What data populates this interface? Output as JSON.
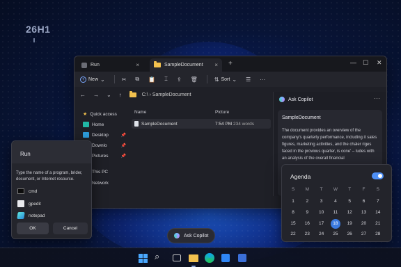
{
  "desktop": {
    "version_label": "26H1"
  },
  "explorer": {
    "tabs": [
      {
        "label": "Run",
        "close": "×"
      },
      {
        "label": "SampleDocument",
        "close": "×"
      }
    ],
    "new_tab": "+",
    "controls": {
      "minimize": "—",
      "maximize": "☐",
      "close": "✕"
    },
    "toolbar": {
      "new_label": "New",
      "sort_label": "Sort",
      "more": "···"
    },
    "address": {
      "path": "C:\\ › SampleDocument"
    },
    "sidebar": [
      {
        "label": "Quick access",
        "icon": "star-icon"
      },
      {
        "label": "Home",
        "icon": "home-icon"
      },
      {
        "label": "Desktop",
        "icon": "desktop-icon"
      },
      {
        "label": "Downlo",
        "icon": "download-icon"
      },
      {
        "label": "Pictures",
        "icon": "pictures-icon"
      },
      {
        "label": "This PC",
        "icon": "pc-icon"
      },
      {
        "label": "Network",
        "icon": "network-icon"
      }
    ],
    "columns": {
      "name": "Name",
      "picture": "Picture"
    },
    "files": [
      {
        "name": "SampleDocument",
        "time": "7:54 PM",
        "size": "234 words"
      }
    ]
  },
  "copilot_panel": {
    "title": "Ask Copilot",
    "more": "···",
    "card_title": "SampleDocument",
    "card_body": "The document provides an overview of the company's quarterly performance, including it sales figures, marketing activities, and the chaler riges faced in the provious quarter, is cone' – ludes with an analysis of the overall financial"
  },
  "run_dialog": {
    "title": "Run",
    "description": "Type the name of a program, brider, document, or Internet resource.",
    "items": [
      {
        "label": "cmd",
        "icon": "cmd-icon"
      },
      {
        "label": "gpedit",
        "icon": "gpedit-icon"
      },
      {
        "label": "notepad",
        "icon": "notepad-icon"
      }
    ],
    "ok_label": "OK",
    "cancel_label": "Cancel"
  },
  "ask_copilot_pill": {
    "label": "Ask Copilot"
  },
  "agenda": {
    "title": "Agenda",
    "toggle_on": true,
    "weekdays": [
      "S",
      "M",
      "T",
      "W",
      "T",
      "F",
      "S"
    ],
    "weeks": [
      [
        "1",
        "2",
        "3",
        "4",
        "5",
        "6",
        "7"
      ],
      [
        "8",
        "9",
        "10",
        "11",
        "12",
        "13",
        "14"
      ],
      [
        "15",
        "16",
        "17",
        "18",
        "19",
        "20",
        "21"
      ],
      [
        "22",
        "23",
        "24",
        "25",
        "26",
        "27",
        "28"
      ]
    ],
    "selected": "18"
  },
  "taskbar": {
    "icons": [
      "windows-start-icon",
      "search-icon",
      "task-view-icon",
      "file-explorer-icon",
      "edge-icon",
      "store-icon",
      "app-icon"
    ]
  },
  "colors": {
    "accent": "#3b7ae0",
    "folder": "#f2c14e",
    "window_bg": "#1f2027"
  }
}
